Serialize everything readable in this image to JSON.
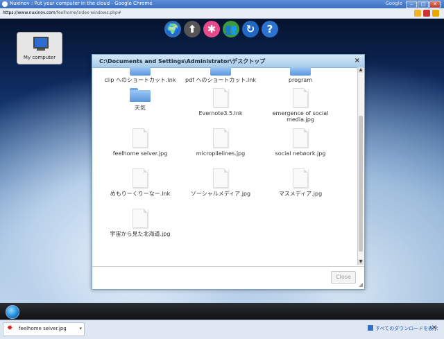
{
  "browser": {
    "title": "Nuxinov : Put your computer in the cloud - Google Chrome",
    "right_text": "Google",
    "url_host": "https://www.nuxinov.com",
    "url_path": "/feelhome/index-windows.php#",
    "min_label": "–",
    "max_label": "□",
    "close_label": "✕"
  },
  "toolbar_icons": [
    {
      "name": "globe-icon",
      "glyph": "🌍",
      "color": "#2f6db5"
    },
    {
      "name": "upload-icon",
      "glyph": "⬆",
      "color": "#555555"
    },
    {
      "name": "pinwheel-icon",
      "glyph": "✱",
      "color": "#e64a8b"
    },
    {
      "name": "users-icon",
      "glyph": "👥",
      "color": "#3c9a3c"
    },
    {
      "name": "refresh-icon",
      "glyph": "↻",
      "color": "#1f69c4"
    },
    {
      "name": "help-icon",
      "glyph": "?",
      "color": "#2b73cf"
    }
  ],
  "desktop": {
    "my_computer_label": "My computer"
  },
  "window": {
    "title": "C:\\Documents and Settings\\Administrator\\デスクトップ",
    "close_glyph": "×",
    "close_button": "Close",
    "files": [
      {
        "name": "clip へのショートカット.lnk",
        "type": "folder-partial"
      },
      {
        "name": "pdf へのショートカット.lnk",
        "type": "folder-partial"
      },
      {
        "name": "program",
        "type": "folder-partial"
      },
      {
        "name": "天気",
        "type": "folder"
      },
      {
        "name": "Evernote3.5.lnk",
        "type": "doc"
      },
      {
        "name": "emergence of social media.jpg",
        "type": "doc"
      },
      {
        "name": "feelhome seiver.jpg",
        "type": "doc"
      },
      {
        "name": "micropilelines.jpg",
        "type": "doc"
      },
      {
        "name": "social network.jpg",
        "type": "doc"
      },
      {
        "name": "めもりーくりーなー.lnk",
        "type": "doc"
      },
      {
        "name": "ソーシャルメディア.jpg",
        "type": "doc"
      },
      {
        "name": "マスメディア.jpg",
        "type": "doc"
      },
      {
        "name": "宇宙から見た北海道.jpg",
        "type": "doc"
      }
    ]
  },
  "downloads": {
    "item_name": "feelhome seiver.jpg",
    "show_all": "すべてのダウンロードを表示",
    "close_glyph": "×"
  },
  "colors": {
    "accent": "#3a6fc0",
    "window_header": "#a7cbe9"
  }
}
